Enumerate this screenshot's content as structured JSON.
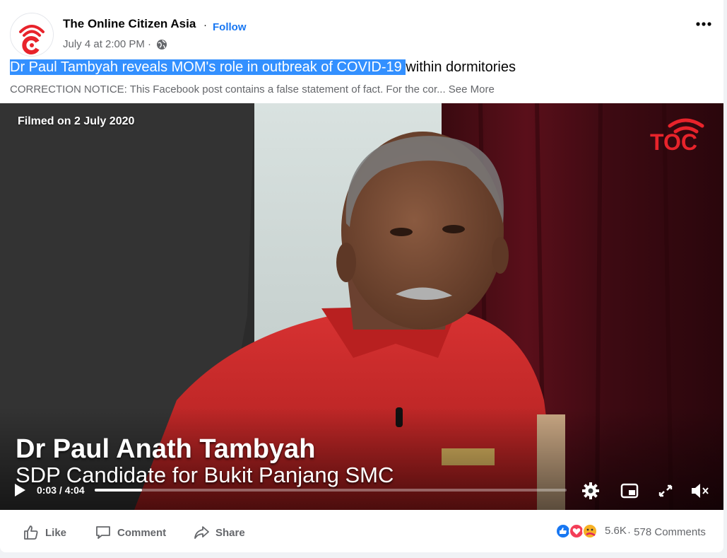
{
  "post": {
    "page_name": "The Online Citizen Asia",
    "separator": "·",
    "follow_label": "Follow",
    "timestamp": "July 4 at 2:00 PM ·",
    "privacy_icon": "globe-icon",
    "more_icon": "more-horizontal-icon",
    "title_highlighted": "Dr Paul Tambyah reveals MOM's role in outbreak of COVID-19 ",
    "title_rest": "within dormitories",
    "notice_text": "CORRECTION NOTICE: This Facebook post contains a false statement of fact. For the cor...",
    "see_more_label": "See More"
  },
  "video": {
    "filmed_label": "Filmed on 2 July 2020",
    "logo_text": "TOC",
    "lower_third_name": "Dr Paul Anath Tambyah",
    "lower_third_subtitle": "SDP Candidate for Bukit Panjang SMC",
    "time_display": "0:03 / 4:04",
    "progress_fraction": 0.012,
    "controls": [
      "play-icon",
      "settings-gear-icon",
      "picture-in-picture-icon",
      "fullscreen-icon",
      "mute-icon"
    ]
  },
  "actions": {
    "like_label": "Like",
    "comment_label": "Comment",
    "share_label": "Share"
  },
  "engagement": {
    "reaction_icons": [
      "like-reaction-icon",
      "love-reaction-icon",
      "care-reaction-icon"
    ],
    "reaction_count": "5.6K",
    "separator": "·",
    "comments_count": "578 Comments"
  },
  "colors": {
    "brand_red": "#e8232b",
    "link_blue": "#1877f2",
    "highlight": "#3390ff",
    "muted_text": "#65676b",
    "shirt_red": "#cf2a2a"
  }
}
